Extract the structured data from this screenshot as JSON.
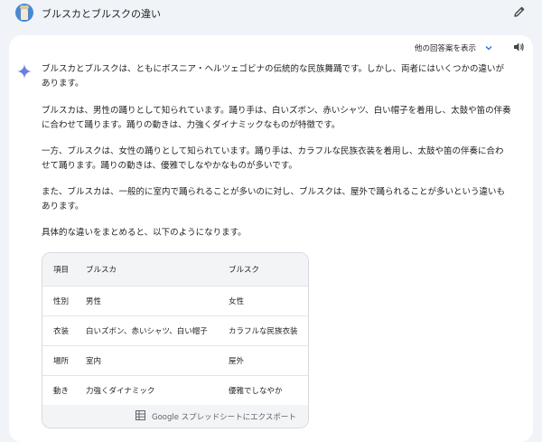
{
  "header": {
    "title": "ブルスカとブルスクの違い"
  },
  "toolbar": {
    "drafts_label": "他の回答案を表示"
  },
  "response": {
    "paragraphs": [
      "ブルスカとブルスクは、ともにボスニア・ヘルツェゴビナの伝統的な民族舞踊です。しかし、両者にはいくつかの違いがあります。",
      "ブルスカは、男性の踊りとして知られています。踊り手は、白いズボン、赤いシャツ、白い帽子を着用し、太鼓や笛の伴奏に合わせて踊ります。踊りの動きは、力強くダイナミックなものが特徴です。",
      "一方、ブルスクは、女性の踊りとして知られています。踊り手は、カラフルな民族衣装を着用し、太鼓や笛の伴奏に合わせて踊ります。踊りの動きは、優雅でしなやかなものが多いです。",
      "また、ブルスカは、一般的に室内で踊られることが多いのに対し、ブルスクは、屋外で踊られることが多いという違いもあります。",
      "具体的な違いをまとめると、以下のようになります。"
    ]
  },
  "table": {
    "headers": [
      "項目",
      "ブルスカ",
      "ブルスク"
    ],
    "rows": [
      [
        "性別",
        "男性",
        "女性"
      ],
      [
        "衣装",
        "白いズボン、赤いシャツ、白い帽子",
        "カラフルな民族衣装"
      ],
      [
        "場所",
        "室内",
        "屋外"
      ],
      [
        "動き",
        "力強くダイナミック",
        "優雅でしなやか"
      ]
    ],
    "export_label": "Google スプレッドシートにエクスポート"
  },
  "icons": {
    "avatar": "avatar",
    "edit": "pencil-icon",
    "chevron": "chevron-down-icon",
    "speaker": "speaker-icon",
    "spark": "gemini-spark-icon",
    "export": "sheets-icon"
  },
  "colors": {
    "background": "#f0f4f9",
    "card": "#ffffff",
    "accent": "#1a73e8"
  }
}
